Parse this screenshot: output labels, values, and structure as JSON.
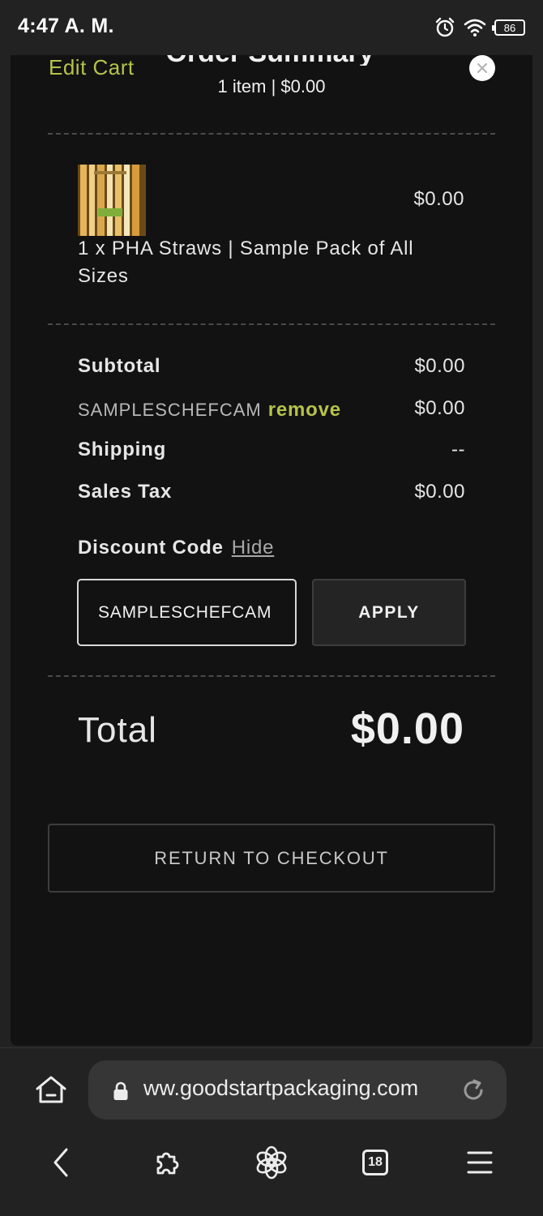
{
  "status_bar": {
    "time": "4:47 A. M.",
    "battery": "86",
    "icons": [
      "alarm-icon",
      "wifi-icon",
      "battery-icon"
    ]
  },
  "cart": {
    "edit_cart": "Edit Cart",
    "title": "Order Summary",
    "subtitle": "1 item | $0.00",
    "close_icon": "close-icon",
    "item": {
      "name": "1 x PHA Straws | Sample Pack of All Sizes",
      "price": "$0.00",
      "thumbnail": "product-thumbnail"
    },
    "summary": {
      "subtotal_label": "Subtotal",
      "subtotal_value": "$0.00",
      "code_label": "SAMPLESCHEFCAM",
      "remove_label": "remove",
      "code_value": "$0.00",
      "shipping_label": "Shipping",
      "shipping_value": "--",
      "tax_label": "Sales Tax",
      "tax_value": "$0.00"
    },
    "discount": {
      "heading": "Discount Code",
      "hide_label": "Hide",
      "input_value": "SAMPLESCHEFCAM",
      "apply_label": "APPLY"
    },
    "total_label": "Total",
    "total_value": "$0.00",
    "return_label": "RETURN TO CHECKOUT"
  },
  "browser": {
    "url": "ww.goodstartpackaging.com",
    "tab_count": "18",
    "nav_icons": [
      "back-icon",
      "extensions-icon",
      "chatgpt-icon",
      "tabs-icon",
      "menu-icon"
    ]
  },
  "colors": {
    "accent": "#b5c34a",
    "panel_bg": "#121212",
    "chrome_bg": "#222222"
  }
}
